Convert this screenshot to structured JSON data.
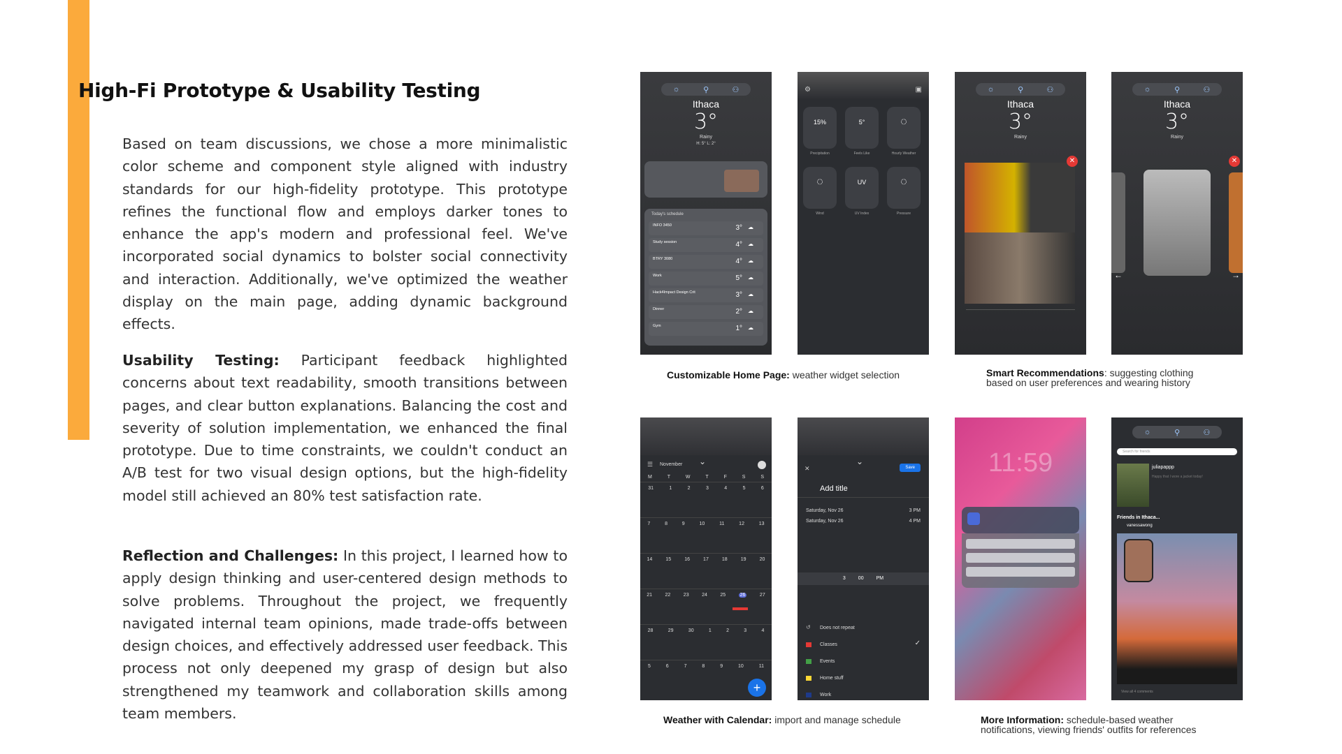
{
  "title": "High-Fi Prototype & Usability Testing",
  "paragraphs": {
    "intro": "Based on team discussions, we chose a more minimalistic color scheme and component style aligned with industry standards for our high-fidelity prototype. This prototype refines the functional flow and employs darker tones to enhance the app's modern and professional feel. We've incorporated social dynamics to bolster social connectivity and interaction. Additionally, we've optimized the weather display on the main page, adding dynamic background effects.",
    "usability_label": "Usability Testing:",
    "usability_text": " Participant feedback highlighted concerns about text readability, smooth transitions between pages, and clear button explanations. Balancing the cost and severity of solution implementation, we enhanced the final prototype. Due to time constraints, we couldn't conduct an A/B test for two visual design options, but the high-fidelity model still achieved an 80% test satisfaction rate.",
    "reflection_label": "Reflection and Challenges:",
    "reflection_text": " In this project, I learned how to apply design thinking and user-centered design methods to solve problems. Throughout the project, we frequently navigated internal team opinions, made trade-offs between design choices, and effectively addressed user feedback. This process not only deepened my grasp of design but also strengthened my teamwork and collaboration skills among team members."
  },
  "captions": {
    "home_label": "Customizable Home Page:",
    "home_text": " weather widget selection",
    "smart_label": "Smart Recommendations",
    "smart_text_1": ": suggesting clothing",
    "smart_text_2": "based on user preferences and wearing history",
    "calendar_label": "Weather with Calendar:",
    "calendar_text": " import  and manage schedule",
    "more_label": "More Information:",
    "more_text_1": " schedule-based weather",
    "more_text_2": "notifications, viewing friends' outfits for references"
  },
  "phone": {
    "city": "Ithaca",
    "temp": "3°",
    "condition": "Rainy",
    "hilo": "H: 5°  L: 2°",
    "schedule_header": "Today's schedule",
    "schedule": [
      {
        "name": "INFO 3450",
        "temp": "3°"
      },
      {
        "name": "Study session",
        "temp": "4°"
      },
      {
        "name": "BTRY 3080",
        "temp": "4°"
      },
      {
        "name": "Work",
        "temp": "5°"
      },
      {
        "name": "Hack4Impact Design Crit",
        "temp": "3°"
      },
      {
        "name": "Dinner",
        "temp": "2°"
      },
      {
        "name": "Gym",
        "temp": "1°"
      }
    ],
    "tiles": [
      {
        "value": "15%",
        "label": "Precipitation"
      },
      {
        "value": "5°",
        "label": "Feels Like"
      },
      {
        "value": "",
        "label": "Hourly Weather"
      },
      {
        "value": "",
        "label": "Wind"
      },
      {
        "value": "UV",
        "label": "UV Index"
      },
      {
        "value": "",
        "label": "Pressure"
      }
    ],
    "calendar_month": "November",
    "weekdays": [
      "M",
      "T",
      "W",
      "T",
      "F",
      "S",
      "S"
    ],
    "weeks": [
      [
        "31",
        "1",
        "2",
        "3",
        "4",
        "5",
        "6"
      ],
      [
        "7",
        "8",
        "9",
        "10",
        "11",
        "12",
        "13"
      ],
      [
        "14",
        "15",
        "16",
        "17",
        "18",
        "19",
        "20"
      ],
      [
        "21",
        "22",
        "23",
        "24",
        "25",
        "26",
        "27"
      ],
      [
        "28",
        "29",
        "30",
        "1",
        "2",
        "3",
        "4"
      ],
      [
        "5",
        "6",
        "7",
        "8",
        "9",
        "10",
        "11"
      ]
    ],
    "event_add_title": "Add title",
    "event_save": "Save",
    "event_dates": [
      {
        "date": "Saturday, Nov 26",
        "time": "3 PM"
      },
      {
        "date": "Saturday, Nov 26",
        "time": "4 PM"
      }
    ],
    "event_picker": [
      "3",
      "00",
      "PM"
    ],
    "event_options": [
      "Does not repeat",
      "Classes",
      "Events",
      "Home stuff",
      "Work"
    ],
    "lock_time": "11:59",
    "friend_search": "Search for friends",
    "friend_user": "juliapappp",
    "friend_post": "Happy that I wore a jacket today!",
    "friends_header": "Friends in Ithaca...",
    "friend_user2": "vanessawong",
    "comments": "View all 4 comments"
  },
  "colors": {
    "accent": "#FBAA3C",
    "phone_bg": "#2b2d31",
    "calendar_today": "#e53935",
    "save_blue": "#1a73e8"
  }
}
